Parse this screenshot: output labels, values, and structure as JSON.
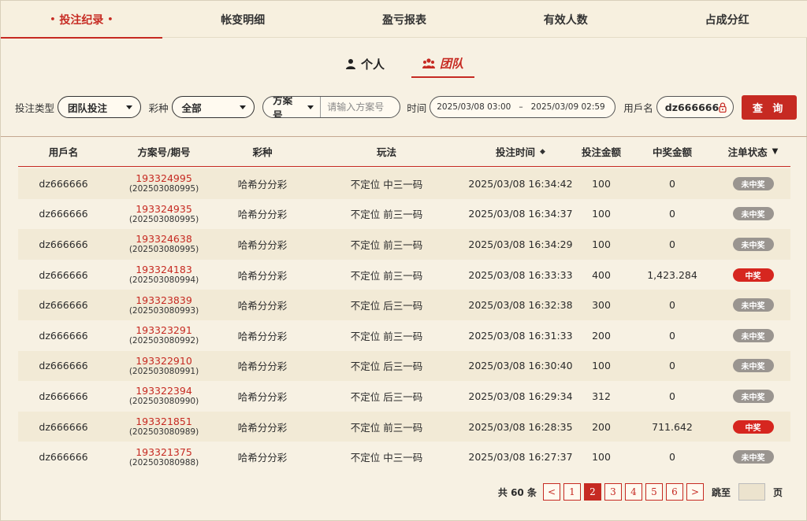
{
  "top_tabs": [
    {
      "label": "投注纪录",
      "active": true
    },
    {
      "label": "帐变明细",
      "active": false
    },
    {
      "label": "盈亏报表",
      "active": false
    },
    {
      "label": "有效人数",
      "active": false
    },
    {
      "label": "占成分红",
      "active": false
    }
  ],
  "sub_tabs": {
    "personal": "个人",
    "team": "团队"
  },
  "filters": {
    "bet_type_label": "投注类型",
    "bet_type_value": "团队投注",
    "lottery_label": "彩种",
    "lottery_value": "全部",
    "plan_select": "方案号",
    "plan_placeholder": "请输入方案号",
    "time_label": "时间",
    "time_start": "2025/03/08 03:00",
    "time_sep": "–",
    "time_end": "2025/03/09 02:59",
    "username_label": "用戶名",
    "username_value": "dz666666",
    "query_button": "查 询"
  },
  "table": {
    "headers": [
      "用戶名",
      "方案号/期号",
      "彩种",
      "玩法",
      "投注时间",
      "投注金额",
      "中奖金额",
      "注单状态"
    ],
    "rows": [
      {
        "user": "dz666666",
        "plan": "193324995",
        "period": "(202503080995)",
        "lottery": "哈希分分彩",
        "play": "不定位 中三一码",
        "time": "2025/03/08 16:34:42",
        "amount": "100",
        "prize": "0",
        "status": "未中奖",
        "win": false
      },
      {
        "user": "dz666666",
        "plan": "193324935",
        "period": "(202503080995)",
        "lottery": "哈希分分彩",
        "play": "不定位 前三一码",
        "time": "2025/03/08 16:34:37",
        "amount": "100",
        "prize": "0",
        "status": "未中奖",
        "win": false
      },
      {
        "user": "dz666666",
        "plan": "193324638",
        "period": "(202503080995)",
        "lottery": "哈希分分彩",
        "play": "不定位 前三一码",
        "time": "2025/03/08 16:34:29",
        "amount": "100",
        "prize": "0",
        "status": "未中奖",
        "win": false
      },
      {
        "user": "dz666666",
        "plan": "193324183",
        "period": "(202503080994)",
        "lottery": "哈希分分彩",
        "play": "不定位 前三一码",
        "time": "2025/03/08 16:33:33",
        "amount": "400",
        "prize": "1,423.284",
        "status": "中奖",
        "win": true
      },
      {
        "user": "dz666666",
        "plan": "193323839",
        "period": "(202503080993)",
        "lottery": "哈希分分彩",
        "play": "不定位 后三一码",
        "time": "2025/03/08 16:32:38",
        "amount": "300",
        "prize": "0",
        "status": "未中奖",
        "win": false
      },
      {
        "user": "dz666666",
        "plan": "193323291",
        "period": "(202503080992)",
        "lottery": "哈希分分彩",
        "play": "不定位 前三一码",
        "time": "2025/03/08 16:31:33",
        "amount": "200",
        "prize": "0",
        "status": "未中奖",
        "win": false
      },
      {
        "user": "dz666666",
        "plan": "193322910",
        "period": "(202503080991)",
        "lottery": "哈希分分彩",
        "play": "不定位 后三一码",
        "time": "2025/03/08 16:30:40",
        "amount": "100",
        "prize": "0",
        "status": "未中奖",
        "win": false
      },
      {
        "user": "dz666666",
        "plan": "193322394",
        "period": "(202503080990)",
        "lottery": "哈希分分彩",
        "play": "不定位 后三一码",
        "time": "2025/03/08 16:29:34",
        "amount": "312",
        "prize": "0",
        "status": "未中奖",
        "win": false
      },
      {
        "user": "dz666666",
        "plan": "193321851",
        "period": "(202503080989)",
        "lottery": "哈希分分彩",
        "play": "不定位 前三一码",
        "time": "2025/03/08 16:28:35",
        "amount": "200",
        "prize": "711.642",
        "status": "中奖",
        "win": true
      },
      {
        "user": "dz666666",
        "plan": "193321375",
        "period": "(202503080988)",
        "lottery": "哈希分分彩",
        "play": "不定位 中三一码",
        "time": "2025/03/08 16:27:37",
        "amount": "100",
        "prize": "0",
        "status": "未中奖",
        "win": false
      }
    ]
  },
  "pagination": {
    "total_text": "共 60 条",
    "prev": "<",
    "next": ">",
    "pages": [
      "1",
      "2",
      "3",
      "4",
      "5",
      "6"
    ],
    "current": "2",
    "jump_label": "跳至",
    "page_unit": "页"
  },
  "colors": {
    "accent": "#c62a22",
    "background": "#f7f1e3",
    "row_alt": "#f2ead6",
    "badge_lose": "#9a9590",
    "badge_win": "#d6261f"
  }
}
